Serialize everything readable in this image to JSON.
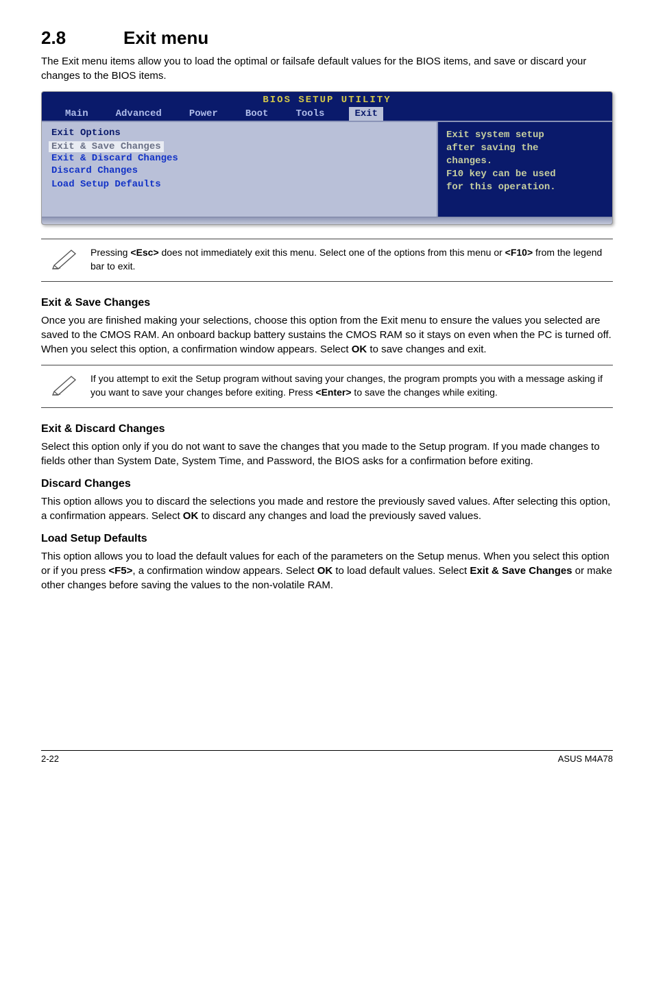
{
  "heading": {
    "num": "2.8",
    "title": "Exit menu"
  },
  "intro": "The Exit menu items allow you to load the optimal or failsafe default values for the BIOS items, and save or discard your changes to the BIOS items.",
  "bios": {
    "util_title": "BIOS SETUP UTILITY",
    "tabs": [
      "Main",
      "Advanced",
      "Power",
      "Boot",
      "Tools",
      "Exit"
    ],
    "left_title": "Exit Options",
    "items": [
      "Exit & Save Changes",
      "Exit & Discard Changes",
      "Discard Changes",
      "",
      "Load Setup Defaults"
    ],
    "help": {
      "l1": "Exit system setup",
      "l2": "after saving the",
      "l3": "changes.",
      "blank": "",
      "l4": "F10 key can be used",
      "l5": "for this operation."
    }
  },
  "note1": {
    "text_a": "Pressing ",
    "esc": "<Esc>",
    "text_b": " does not immediately exit this menu. Select one of the options from this menu or ",
    "f10": "<F10>",
    "text_c": " from the legend bar to exit."
  },
  "save": {
    "head": "Exit & Save Changes",
    "p_a": "Once you are finished making your selections, choose this option from the Exit menu to ensure the values you selected are saved to the CMOS RAM. An onboard backup battery sustains the CMOS RAM so it stays on even when the PC is turned off. When you select this option, a confirmation window appears. Select ",
    "ok": "OK",
    "p_b": " to save changes and exit."
  },
  "note2": {
    "text_a": " If you attempt to exit the Setup program without saving your changes, the program prompts you with a message asking if you want to save your changes before exiting. Press ",
    "enter": "<Enter>",
    "text_b": " to save the  changes while exiting."
  },
  "discard_exit": {
    "head": "Exit & Discard Changes",
    "p": "Select this option only if you do not want to save the changes that you  made to the Setup program. If you made changes to fields other than System Date, System Time, and Password, the BIOS asks for a confirmation before exiting."
  },
  "discard": {
    "head": "Discard Changes",
    "p_a": "This option allows you to discard the selections you made and restore the previously saved values. After selecting this option, a confirmation appears. Select ",
    "ok": "OK",
    "p_b": " to discard any changes and load the previously saved values."
  },
  "defaults": {
    "head": "Load Setup Defaults",
    "p_a": "This option allows you to load the default values for each of the parameters on the Setup menus. When you select this option or if you press ",
    "f5": "<F5>",
    "p_b": ", a confirmation window appears. Select ",
    "ok1": "OK",
    "p_c": " to load default values. Select ",
    "exitsave": "Exit & Save Changes",
    "p_d": " or make other changes before saving the values to the non-volatile RAM."
  },
  "footer": {
    "left": "2-22",
    "right": "ASUS M4A78"
  }
}
